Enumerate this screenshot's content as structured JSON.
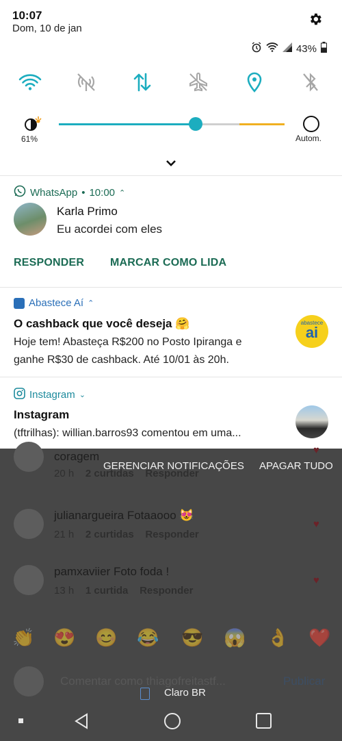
{
  "status": {
    "time": "10:07",
    "date": "Dom, 10 de jan",
    "battery": "43%"
  },
  "brightness": {
    "percent": "61%",
    "auto_label": "Autom.",
    "level": 0.61
  },
  "notifications": [
    {
      "app": "WhatsApp",
      "time": "10:00",
      "sender": "Karla Primo",
      "message": "Eu acordei com eles",
      "actions": [
        "RESPONDER",
        "MARCAR COMO LIDA"
      ]
    },
    {
      "app": "Abastece Aí",
      "title": "O cashback que você deseja 🤗",
      "body_line1": "Hoje tem! Abasteça R$200 no Posto Ipiranga e",
      "body_line2": "ganhe R$30 de cashback. Até 10/01 às 20h.",
      "logo_text": "ai",
      "logo_small": "abastece"
    },
    {
      "app": "Instagram",
      "title": "Instagram",
      "body": "(tftrilhas): willian.barros93 comentou em uma..."
    }
  ],
  "shade_actions": {
    "manage": "GERENCIAR NOTIFICAÇÕES",
    "clear": "APAGAR TUDO"
  },
  "background": {
    "comment0": {
      "partial": "coragem",
      "time": "20 h",
      "likes": "2 curtidas",
      "reply": "Responder"
    },
    "comments": [
      {
        "user": "julianargueira",
        "text": "Fotaaooo 😻",
        "time": "21 h",
        "likes": "2 curtidas",
        "reply": "Responder"
      },
      {
        "user": "pamxaviier",
        "text": "Foto foda !",
        "time": "13 h",
        "likes": "1 curtida",
        "reply": "Responder"
      }
    ],
    "emojis": [
      "👏",
      "😍",
      "😊",
      "😂",
      "😎",
      "😱",
      "👌",
      "❤️"
    ],
    "comment_placeholder": "Comentar como thiagofreitastf...",
    "publish": "Publicar",
    "carrier": "Claro BR"
  }
}
